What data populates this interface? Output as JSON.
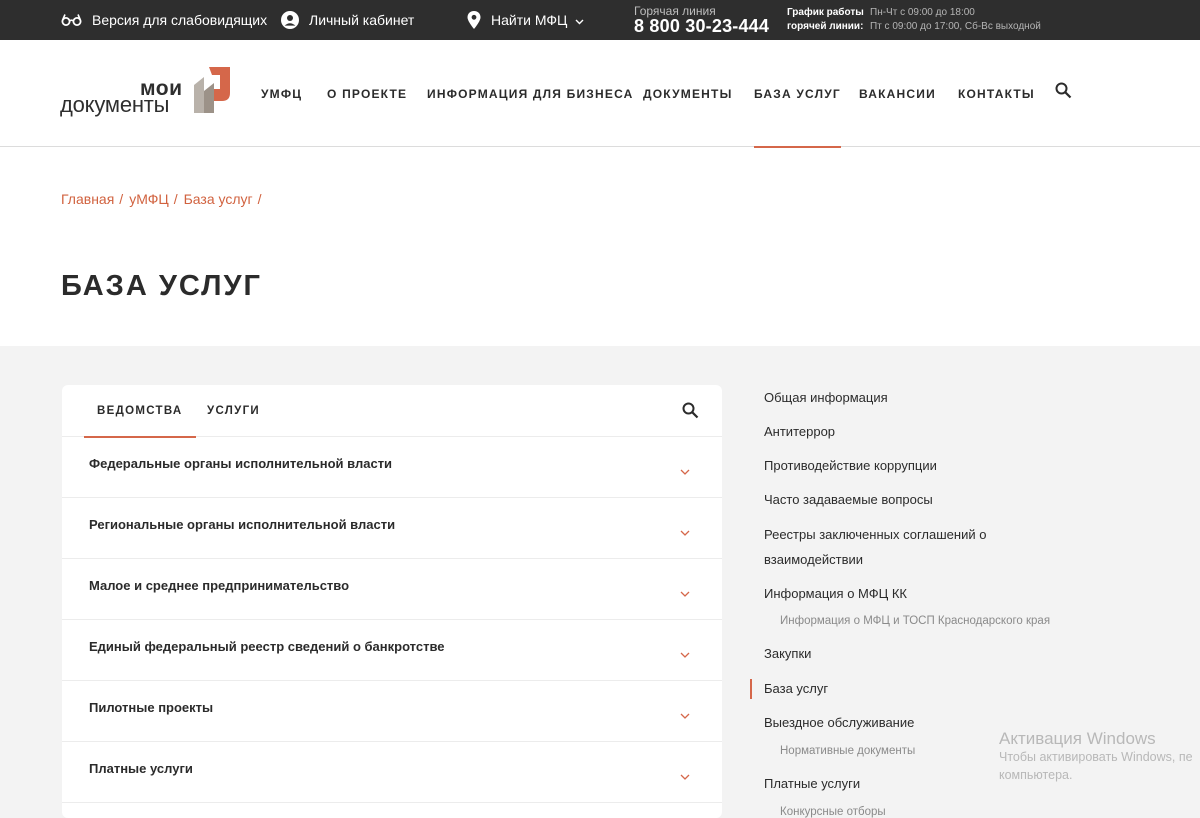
{
  "topbar": {
    "low_vision": "Версия для слабовидящих",
    "account": "Личный кабинет",
    "find_mfc": "Найти МФЦ",
    "hotline_label": "Горячая линия",
    "hotline_phone": "8 800 30-23-444",
    "schedule_label_1": "График работы",
    "schedule_label_2": "горячей линии:",
    "schedule_1": "Пн-Чт с 09:00 до 18:00",
    "schedule_2": "Пт с 09:00 до 17:00, Сб-Вс выходной"
  },
  "logo": {
    "line1": "мои",
    "line2": "документы"
  },
  "nav": {
    "items": [
      {
        "label": "УМФЦ"
      },
      {
        "label": "О ПРОЕКТЕ"
      },
      {
        "label": "ИНФОРМАЦИЯ ДЛЯ БИЗНЕСА"
      },
      {
        "label": "ДОКУМЕНТЫ"
      },
      {
        "label": "БАЗА УСЛУГ",
        "active": true
      },
      {
        "label": "ВАКАНСИИ"
      },
      {
        "label": "КОНТАКТЫ"
      }
    ]
  },
  "breadcrumbs": [
    "Главная",
    "уМФЦ",
    "База услуг"
  ],
  "breadcrumb_sep": "/",
  "page_title": "БАЗА УСЛУГ",
  "tabs": [
    {
      "label": "ВЕДОМСТВА",
      "active": true
    },
    {
      "label": "УСЛУГИ"
    }
  ],
  "categories": [
    "Федеральные органы исполнительной власти",
    "Региональные органы исполнительной власти",
    "Малое и среднее предпринимательство",
    "Единый федеральный реестр сведений о банкротстве",
    "Пилотные проекты",
    "Платные услуги"
  ],
  "side_menu": {
    "items": [
      {
        "label": "Общая информация"
      },
      {
        "label": "Антитеррор"
      },
      {
        "label": "Противодействие коррупции"
      },
      {
        "label": "Часто задаваемые вопросы"
      },
      {
        "label": "Реестры заключенных соглашений о"
      },
      {
        "label": "взаимодействии"
      },
      {
        "label": "Информация о МФЦ КК"
      },
      {
        "label": "Информация о МФЦ и ТОСП Краснодарского края"
      },
      {
        "label": "Закупки"
      },
      {
        "label": "База услуг",
        "active": true
      },
      {
        "label": "Выездное обслуживание"
      },
      {
        "label": "Нормативные документы"
      },
      {
        "label": "Платные услуги"
      },
      {
        "label": "Конкурсные отборы"
      }
    ]
  },
  "watermark": {
    "line1": "Активация Windows",
    "line2": "Чтобы активировать Windows, пе",
    "line3": "компьютера."
  },
  "colors": {
    "accent": "#d5674a",
    "topbar_bg": "#2e2e2e",
    "section_bg": "#f3f3f3"
  }
}
